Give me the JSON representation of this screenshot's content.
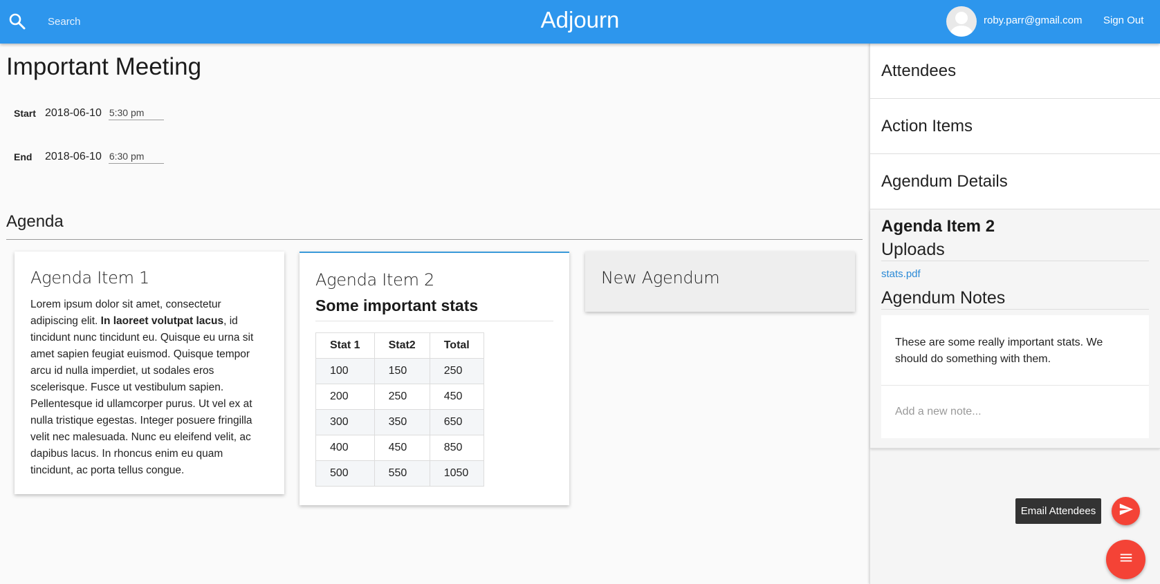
{
  "header": {
    "search_placeholder": "Search",
    "app_title": "Adjourn",
    "user_email": "roby.parr@gmail.com",
    "signout_label": "Sign Out"
  },
  "meeting": {
    "title": "Important Meeting",
    "start": {
      "label": "Start",
      "date": "2018-06-10",
      "time": "5:30 pm"
    },
    "end": {
      "label": "End",
      "date": "2018-06-10",
      "time": "6:30 pm"
    }
  },
  "agenda": {
    "heading": "Agenda",
    "item1": {
      "title": "Agenda Item 1",
      "body_pre": "Lorem ipsum dolor sit amet, consectetur adipiscing elit. ",
      "body_bold": "In laoreet volutpat lacus",
      "body_post": ", id tincidunt nunc tincidunt eu. Quisque eu urna sit amet sapien feugiat euismod. Quisque tempor arcu id nulla imperdiet, ut sodales eros scelerisque. Fusce ut vestibulum sapien. Pellentesque id ullamcorper purus. Ut vel ex at nulla tristique egestas. Integer posuere fringilla velit nec malesuada. Nunc eu eleifend velit, ac dapibus lacus. In rhoncus enim eu quam tincidunt, ac porta tellus congue."
    },
    "item2": {
      "title": "Agenda Item 2",
      "subheading": "Some important stats",
      "table": {
        "headers": [
          "Stat 1",
          "Stat2",
          "Total"
        ],
        "rows": [
          [
            "100",
            "150",
            "250"
          ],
          [
            "200",
            "250",
            "450"
          ],
          [
            "300",
            "350",
            "650"
          ],
          [
            "400",
            "450",
            "850"
          ],
          [
            "500",
            "550",
            "1050"
          ]
        ]
      }
    },
    "new_label": "New Agendum"
  },
  "sidebar": {
    "attendees": "Attendees",
    "action_items": "Action Items",
    "agendum_details": "Agendum Details",
    "selected_item": "Agenda Item 2",
    "uploads_label": "Uploads",
    "upload_file": "stats.pdf",
    "notes_label": "Agendum Notes",
    "note": "These are some really important stats. We should do something with them.",
    "note_placeholder": "Add a new note..."
  },
  "actions": {
    "email_tooltip": "Email Attendees"
  },
  "colors": {
    "header_bg": "#2d96ed",
    "fab": "#f44336",
    "link": "#2b8ad6",
    "selected_card_accent": "#3a9ad9"
  }
}
